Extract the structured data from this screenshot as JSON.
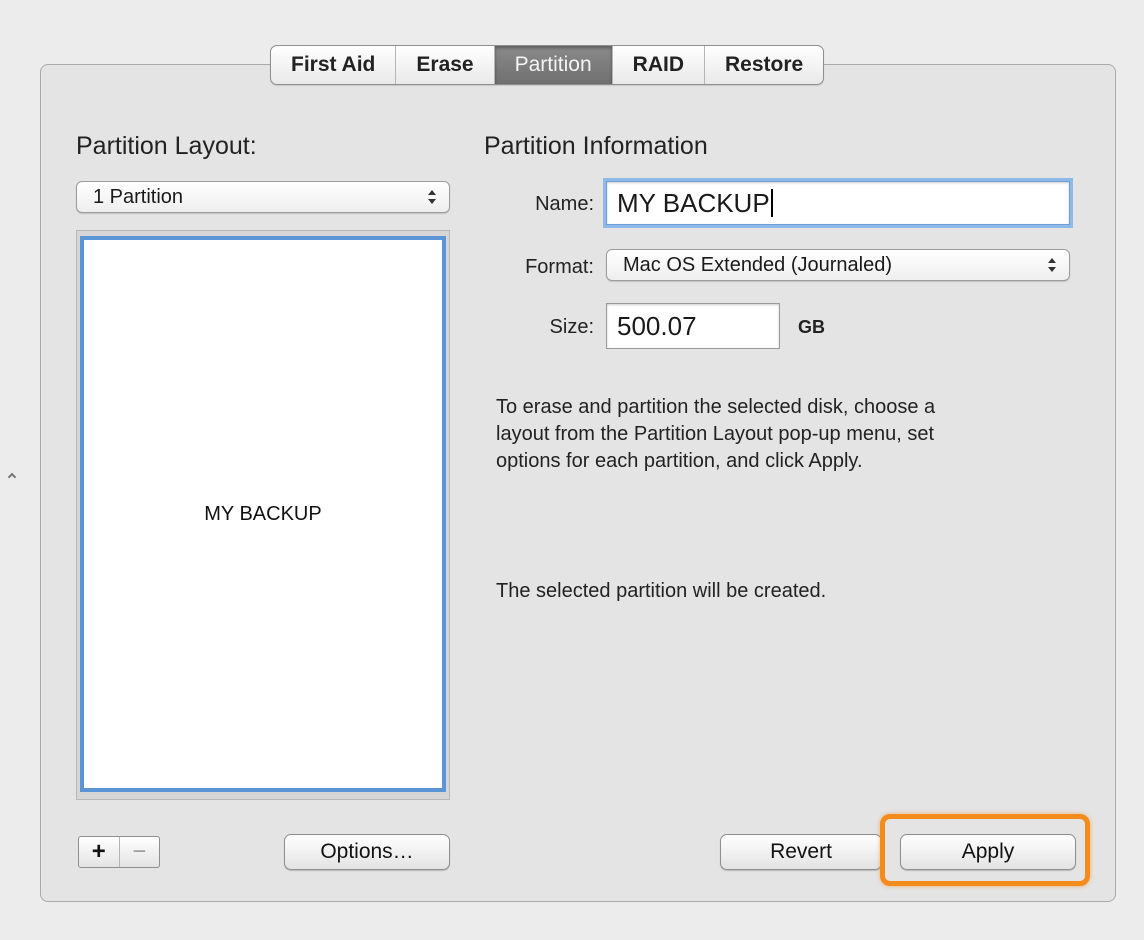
{
  "tabs": [
    {
      "label": "First Aid",
      "selected": false
    },
    {
      "label": "Erase",
      "selected": false
    },
    {
      "label": "Partition",
      "selected": true
    },
    {
      "label": "RAID",
      "selected": false
    },
    {
      "label": "Restore",
      "selected": false
    }
  ],
  "layout_panel": {
    "heading": "Partition Layout:",
    "popup_value": "1 Partition",
    "map_partition_label": "MY BACKUP",
    "add_label": "+",
    "remove_label": "−",
    "options_label": "Options…"
  },
  "info_panel": {
    "heading": "Partition Information",
    "name_label": "Name:",
    "name_value": "MY BACKUP",
    "format_label": "Format:",
    "format_value": "Mac OS Extended (Journaled)",
    "size_label": "Size:",
    "size_value": "500.07",
    "size_unit": "GB",
    "instructions_lines": [
      "To erase and partition the selected disk, choose a",
      "layout from the Partition Layout pop-up menu, set",
      "options for each partition, and click Apply."
    ],
    "status": "The selected partition will be created."
  },
  "buttons": {
    "revert_label": "Revert",
    "apply_label": "Apply"
  },
  "colors": {
    "selection_blue": "#5b95d8",
    "highlight_orange": "#f38b1d",
    "selected_tab": "#7d7d7d"
  }
}
